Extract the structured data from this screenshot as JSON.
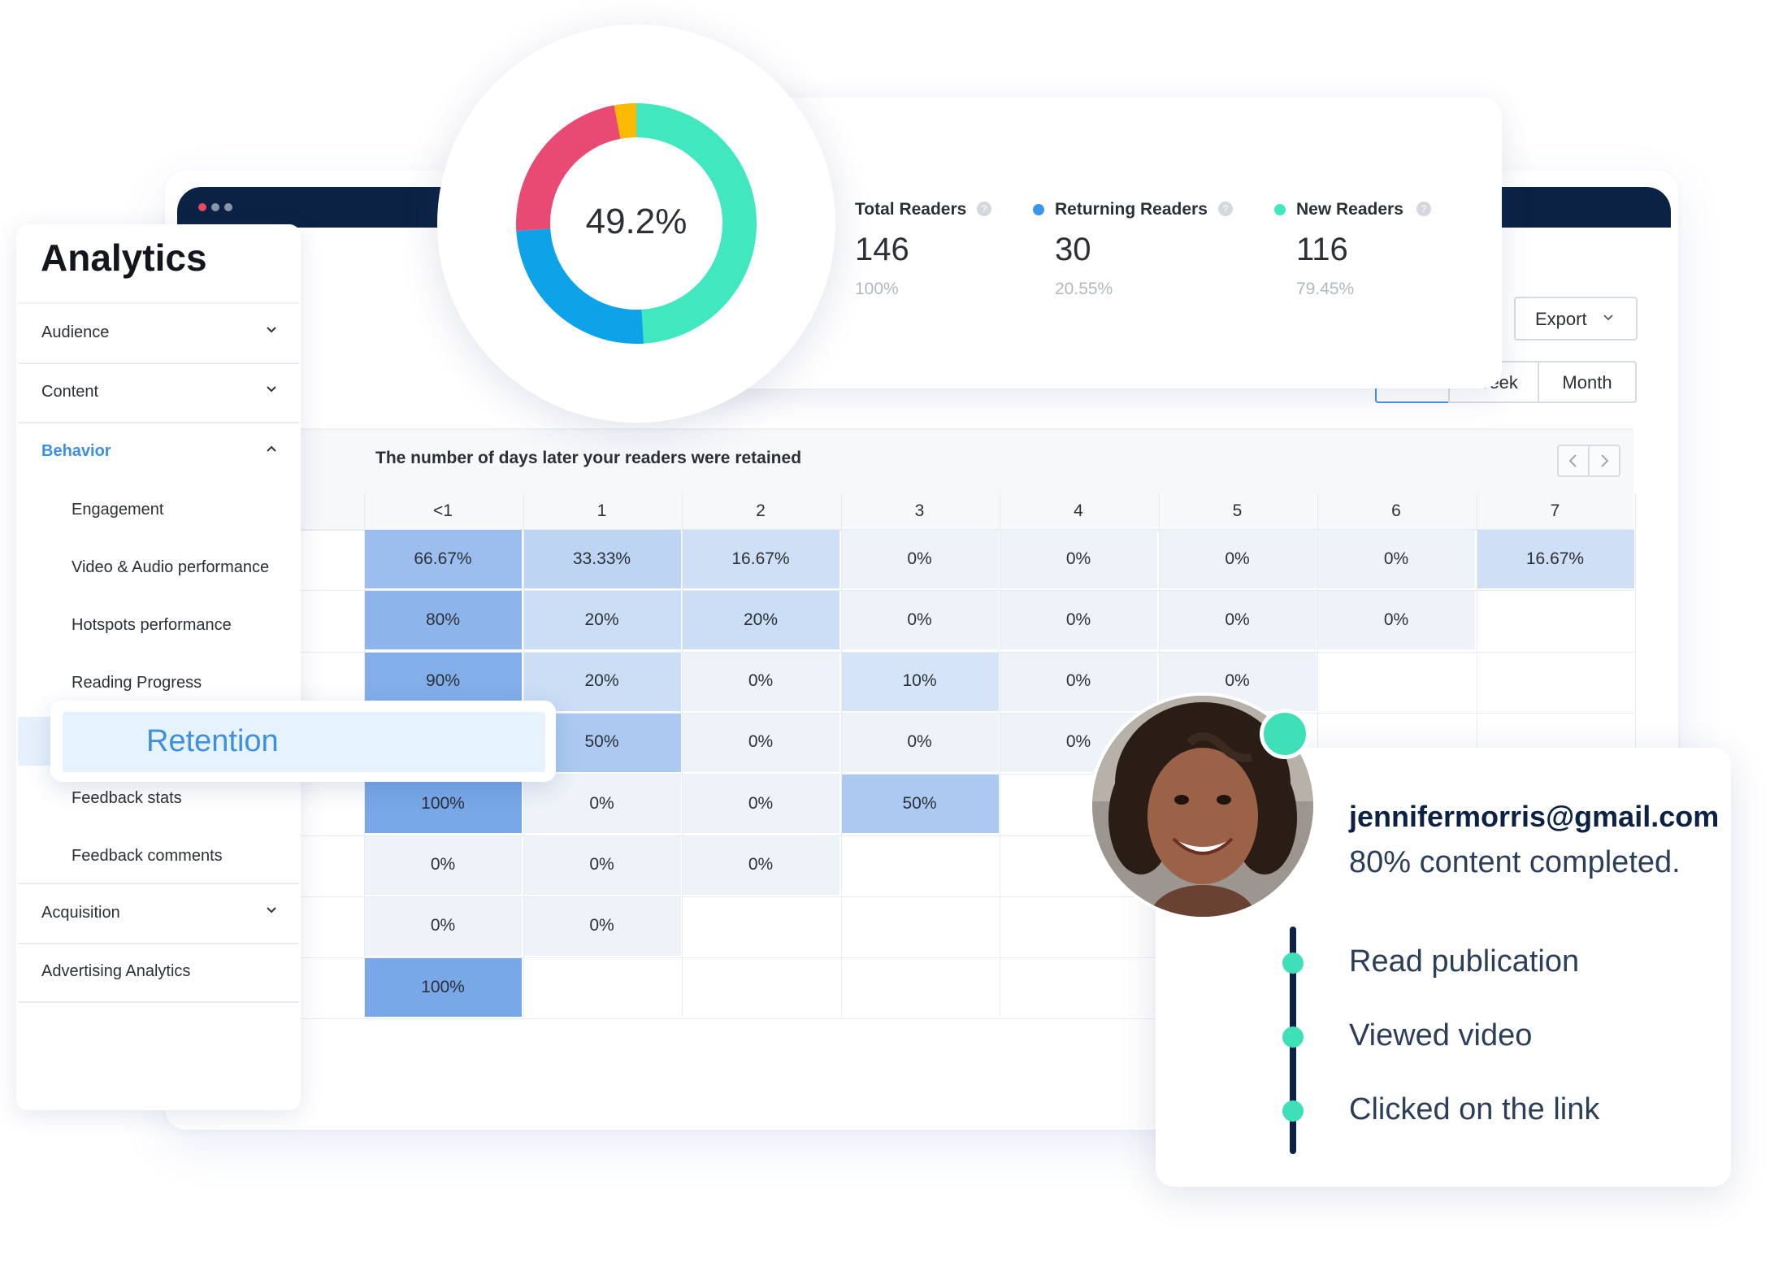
{
  "sidebar": {
    "title": "Analytics",
    "sections": [
      {
        "label": "Audience",
        "expanded": false
      },
      {
        "label": "Content",
        "expanded": false
      },
      {
        "label": "Behavior",
        "expanded": true
      },
      {
        "label": "Acquisition",
        "expanded": false
      },
      {
        "label": "Advertising Analytics"
      }
    ],
    "behavior_items": [
      "Engagement",
      "Video & Audio performance",
      "Hotspots performance",
      "Reading Progress",
      "Retention",
      "Feedback stats",
      "Feedback comments"
    ],
    "active_item": "Retention"
  },
  "toolbar": {
    "export_label": "Export",
    "period_week": "Week",
    "period_month": "Month"
  },
  "retention": {
    "title": "The number of days later your readers were retained",
    "columns": [
      "<1",
      "1",
      "2",
      "3",
      "4",
      "5",
      "6",
      "7"
    ],
    "rows": [
      [
        "66.67%",
        "33.33%",
        "16.67%",
        "0%",
        "0%",
        "0%",
        "0%",
        "16.67%"
      ],
      [
        "80%",
        "20%",
        "20%",
        "0%",
        "0%",
        "0%",
        "0%"
      ],
      [
        "90%",
        "20%",
        "0%",
        "10%",
        "0%",
        "0%"
      ],
      [
        "",
        "50%",
        "0%",
        "0%",
        "0%"
      ],
      [
        "100%",
        "0%",
        "0%",
        "50%"
      ],
      [
        "0%",
        "0%",
        "0%"
      ],
      [
        "0%",
        "0%"
      ],
      [
        "100%"
      ]
    ]
  },
  "stats": {
    "donut_center": "49.2%",
    "donut_segments": [
      {
        "color": "#41e8bf",
        "value": 0.49
      },
      {
        "color": "#0ea3e9",
        "value": 0.25
      },
      {
        "color": "#e94a73",
        "value": 0.23
      },
      {
        "color": "#fbb900",
        "value": 0.03
      }
    ],
    "cards": [
      {
        "label": "Total Readers",
        "value": "146",
        "percent": "100%",
        "dot_color": ""
      },
      {
        "label": "Returning Readers",
        "value": "30",
        "percent": "20.55%",
        "dot_color": "#3b95e8"
      },
      {
        "label": "New Readers",
        "value": "116",
        "percent": "79.45%",
        "dot_color": "#41e8bf"
      }
    ],
    "help_glyph": "?"
  },
  "user": {
    "email": "jennifermorris@gmail.com",
    "progress": "80% content completed.",
    "status_color": "#3fe0b7",
    "timeline": [
      "Read publication",
      "Viewed video",
      "Clicked on the link"
    ]
  },
  "colors": {
    "navy": "#0c2245",
    "accent_blue": "#3d8fe0",
    "accent_green": "#3fe0b7"
  }
}
